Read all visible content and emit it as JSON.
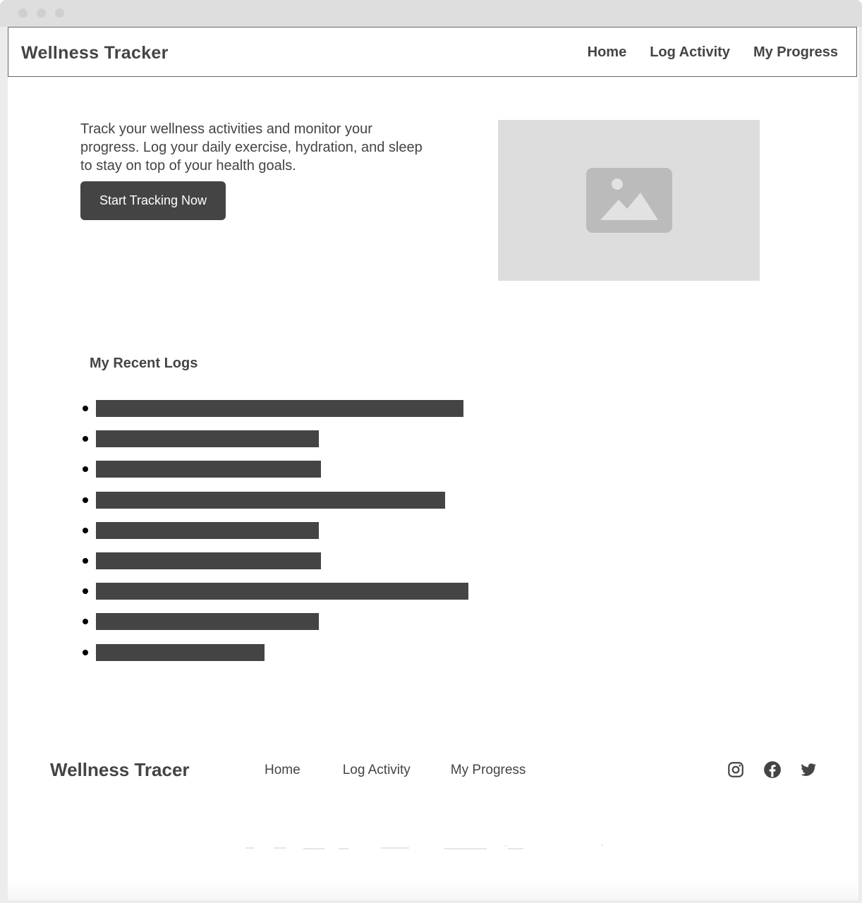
{
  "header": {
    "brand": "Wellness Tracker",
    "nav": [
      "Home",
      "Log Activity",
      "My Progress"
    ]
  },
  "hero": {
    "text": "Track your wellness activities and monitor your progress. Log your daily exercise, hydration, and sleep to stay on top of your health goals.",
    "cta_label": "Start Tracking Now",
    "image_icon": "image-placeholder-icon"
  },
  "logs": {
    "title": "My Recent Logs",
    "count": 9
  },
  "footer": {
    "brand": "Wellness Tracer",
    "nav": [
      "Home",
      "Log Activity",
      "My Progress"
    ],
    "social_icons": [
      "instagram-icon",
      "facebook-icon",
      "twitter-icon"
    ]
  },
  "colors": {
    "text": "#444444",
    "placeholder_bar": "#444444",
    "image_bg": "#dddddd",
    "image_icon": "#bbbbbb"
  }
}
